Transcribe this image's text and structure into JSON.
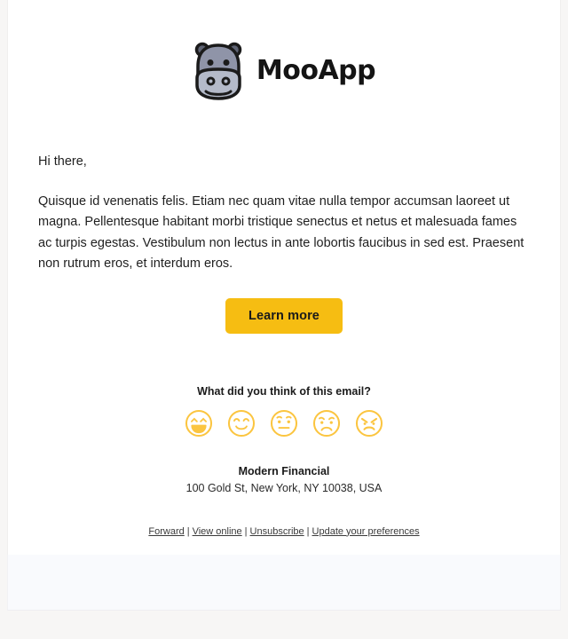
{
  "brand": {
    "wordmark": "MooApp",
    "logo_icon": "hippo-icon",
    "logo_colors": {
      "outline": "#1b1b1b",
      "head_top": "#8f94a8",
      "snout": "#b4bac9",
      "ear": "#5f6474"
    }
  },
  "body": {
    "greeting": "Hi there,",
    "paragraph": "Quisque id venenatis felis. Etiam nec quam vitae nulla tempor accumsan laoreet ut magna. Pellentesque habitant morbi tristique senectus et netus et malesuada fames ac turpis egestas. Vestibulum non lectus in ante lobortis faucibus in sed est. Praesent non rutrum eros, et interdum eros."
  },
  "cta": {
    "label": "Learn more",
    "background": "#f6bd12",
    "text_color": "#1a1a1a"
  },
  "feedback": {
    "question": "What did you think of this email?",
    "stroke_color": "#fbc540",
    "options": [
      {
        "name": "face-very-happy",
        "label": "Very happy"
      },
      {
        "name": "face-happy",
        "label": "Happy"
      },
      {
        "name": "face-neutral",
        "label": "Neutral"
      },
      {
        "name": "face-sad",
        "label": "Sad"
      },
      {
        "name": "face-angry",
        "label": "Angry"
      }
    ]
  },
  "signature": {
    "company": "Modern Financial",
    "address": "100 Gold St, New York, NY 10038, USA"
  },
  "footer": {
    "separator": "|",
    "links": [
      {
        "label": "Forward"
      },
      {
        "label": "View online"
      },
      {
        "label": "Unsubscribe"
      },
      {
        "label": "Update your preferences"
      }
    ]
  }
}
